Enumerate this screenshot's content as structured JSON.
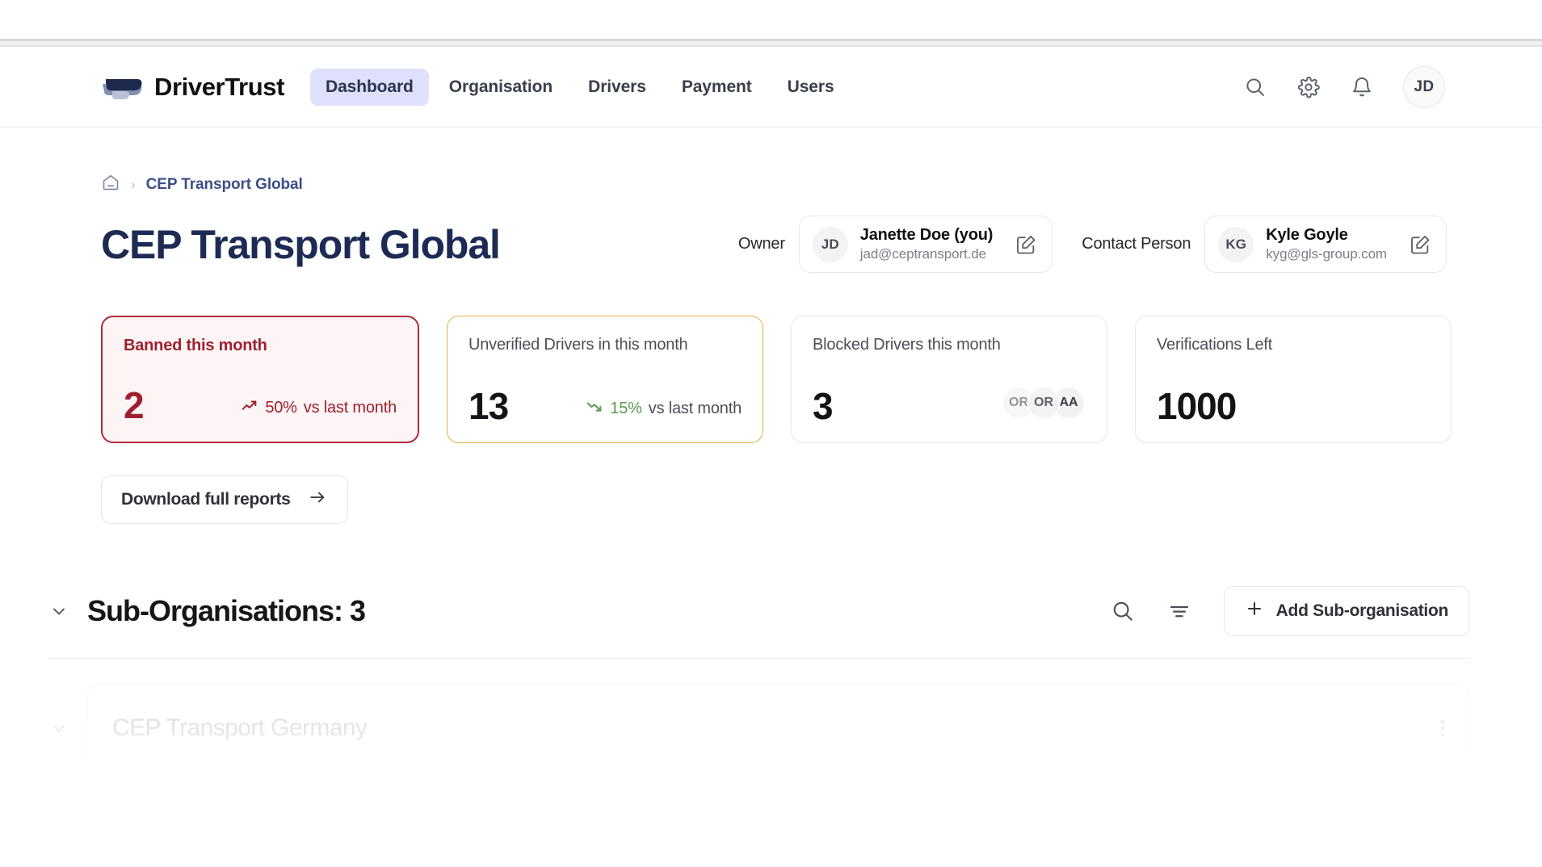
{
  "header": {
    "brand": "DriverTrust",
    "logo_icon": "swoosh-logo",
    "nav": [
      {
        "label": "Dashboard",
        "active": true
      },
      {
        "label": "Organisation",
        "active": false
      },
      {
        "label": "Drivers",
        "active": false
      },
      {
        "label": "Payment",
        "active": false
      },
      {
        "label": "Users",
        "active": false
      }
    ],
    "icons": [
      "search-icon",
      "gear-icon",
      "bell-icon"
    ],
    "avatar_initials": "JD"
  },
  "breadcrumb": {
    "home_icon": "home-icon",
    "separator": "›",
    "current": "CEP Transport Global"
  },
  "page": {
    "title": "CEP Transport Global"
  },
  "owner": {
    "label": "Owner",
    "initials": "JD",
    "name": "Janette Doe (you)",
    "email": "jad@ceptransport.de",
    "edit_icon": "edit-pencil-icon"
  },
  "contact": {
    "label": "Contact Person",
    "initials": "KG",
    "name": "Kyle Goyle",
    "email": "kyg@gls-group.com",
    "edit_icon": "edit-pencil-icon"
  },
  "stats": [
    {
      "label": "Banned this month",
      "value": "2",
      "trend_icon": "trend-up-icon",
      "trend_pct": "50%",
      "trend_sub": "vs last month",
      "style": "danger",
      "color": "#9e2030"
    },
    {
      "label": "Unverified Drivers in this month",
      "value": "13",
      "trend_icon": "trend-down-icon",
      "trend_pct": "15%",
      "trend_sub": "vs last month",
      "style": "warn",
      "color": "#5a9b4e"
    },
    {
      "label": "Blocked Drivers this month",
      "value": "3",
      "avatars": [
        "OR",
        "OR",
        "AA"
      ],
      "style": "plain"
    },
    {
      "label": "Verifications Left",
      "value": "1000",
      "style": "plain"
    }
  ],
  "download_button": {
    "label": "Download full reports",
    "arrow_icon": "arrow-right-icon"
  },
  "sub_organisations": {
    "collapse_icon": "chevron-down-icon",
    "title": "Sub-Organisations: 3",
    "search_icon": "search-icon",
    "filter_icon": "filter-icon",
    "add_label": "Add Sub-organisation",
    "add_icon": "plus-icon",
    "rows": [
      {
        "name": "CEP Transport Germany",
        "menu_icon": "kebab-menu-icon",
        "chevron_icon": "chevron-down-icon"
      }
    ]
  }
}
